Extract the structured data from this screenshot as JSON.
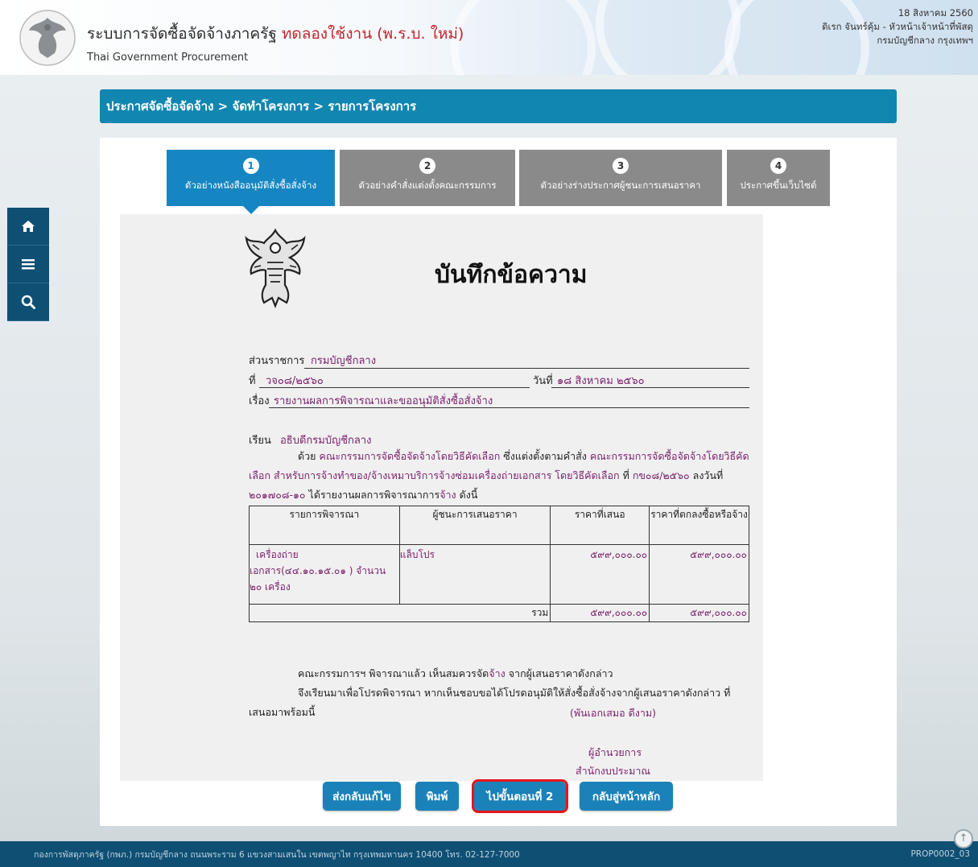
{
  "header": {
    "system_title": "ระบบการจัดซื้อจัดจ้างภาครัฐ",
    "trial_label": "ทดลองใช้งาน (พ.ร.บ. ใหม่)",
    "subtitle": "Thai Government Procurement",
    "date": "18 สิงหาคม 2560",
    "user": "ดิเรก จันทร์คุ้ม - หัวหน้าเจ้าหน้าที่พัสดุ",
    "department": "กรมบัญชีกลาง กรุงเทพฯ"
  },
  "breadcrumb": "ประกาศจัดซื้อจัดจ้าง > จัดทำโครงการ > รายการโครงการ",
  "steps": [
    {
      "num": "1",
      "label": "ตัวอย่างหนังสืออนุมัติสั่งซื้อสั่งจ้าง"
    },
    {
      "num": "2",
      "label": "ตัวอย่างคำสั่งแต่งตั้งคณะกรรมการ"
    },
    {
      "num": "3",
      "label": "ตัวอย่างร่างประกาศผู้ชนะการเสนอราคา"
    },
    {
      "num": "4",
      "label": "ประกาศขึ้นเว็บไซต์"
    }
  ],
  "memo": {
    "title": "บันทึกข้อความ",
    "agency_label": "ส่วนราชการ",
    "agency_value": "กรมบัญชีกลาง",
    "ref_label": "ที่",
    "ref_value": "วจ๐๘/๒๕๖๐",
    "date_label": "วันที่",
    "date_value": "๑๘ สิงหาคม ๒๕๖๐",
    "subject_label": "เรื่อง",
    "subject_value": "รายงานผลการพิจารณาและขออนุมัติสั่งซื้อสั่งจ้าง",
    "to_label": "เรียน",
    "to_value": "อธิบดีกรมบัญชีกลาง",
    "para1": {
      "t1": "ด้วย",
      "p1": "คณะกรรมการจัดซื้อจัดจ้างโดยวิธีคัดเลือก",
      "t2": "ซึ่งแต่งตั้งตามคำสั่ง",
      "p2": "คณะกรรมการจัดซื้อจัดจ้างโดยวิธีคัด",
      "p3": "เลือก สำหรับการจ้างทำของ/จ้างเหมาบริการจ้างซ่อมเครื่องถ่ายเอกสาร โดยวิธีคัดเลือก",
      "t3": "ที่",
      "p4": "กข๐๘/๒๕๖๐",
      "t4": "ลงวันที่",
      "p5": "๒๐๑๗๐๘-๑๐",
      "t5": "ได้รายงานผลการพิจารณาการ",
      "p6": "จ้าง",
      "t6": "ดังนี้"
    },
    "table": {
      "headers": [
        "รายการพิจารณา",
        "ผู้ชนะการเสนอราคา",
        "ราคาที่เสนอ",
        "ราคาที่ตกลงซื้อหรือจ้าง"
      ],
      "item_line1": "เครื่องถ่าย",
      "item_line2": "เอกสาร(๔๔.๑๐.๑๕.๐๑ ) จำนวน",
      "item_line3": "๒๐ เครื่อง",
      "winner": "แล็บโปร",
      "offered": "๕๙๙,๐๐๐.๐๐",
      "agreed": "๕๙๙,๐๐๐.๐๐",
      "total_label": "รวม",
      "total_offered": "๕๙๙,๐๐๐.๐๐",
      "total_agreed": "๕๙๙,๐๐๐.๐๐"
    },
    "para2_a": "คณะกรรมการฯ พิจารณาแล้ว เห็นสมควรจัด",
    "para2_p": "จ้าง",
    "para2_b": "จากผู้เสนอราคาดังกล่าว",
    "para3_line1": "จึงเรียนมาเพื่อโปรดพิจารณา หากเห็นชอบขอได้โปรดอนุมัติให้สั่งซื้อสั่งจ้างจากผู้เสนอราคาดังกล่าว ที่",
    "para3_line2": "เสนอมาพร้อมนี้",
    "signer_name": "(พันเอกเสมอ ดีงาม)",
    "signer_title1": "ผู้อำนวยการ",
    "signer_title2": "สำนักงบประมาณ"
  },
  "buttons": {
    "edit": "ส่งกลับแก้ไข",
    "print": "พิมพ์",
    "next": "ไปขั้นตอนที่ 2",
    "home": "กลับสู่หน้าหลัก"
  },
  "footer": {
    "address": "กองการพัสดุภาครัฐ (กพภ.) กรมบัญชีกลาง ถนนพระราม 6 แขวงสามเสนใน เขตพญาไท กรุงเทพมหานคร 10400 โทร. 02-127-7000",
    "page_code": "PROP0002_03"
  },
  "colors": {
    "accent": "#1186b0",
    "step_active": "#1686c2",
    "step_inactive": "#8a8a8a",
    "trial_red": "#c0262d",
    "value_purple": "#7a1f6b",
    "highlight_red": "#e8141b"
  }
}
